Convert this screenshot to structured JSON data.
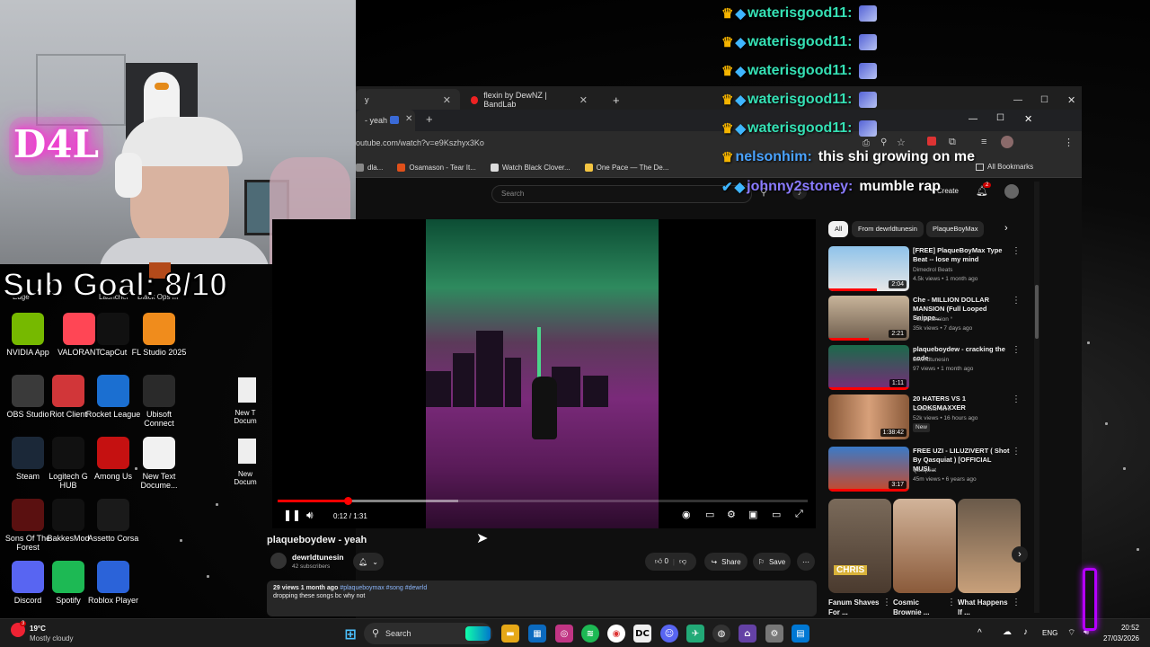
{
  "overlay": {
    "sub_goal": "Sub Goal: 8/10",
    "webcam_neon_text": "D4L",
    "chat": [
      {
        "user": "waterisgood11:",
        "message": ""
      },
      {
        "user": "waterisgood11:",
        "message": ""
      },
      {
        "user": "waterisgood11:",
        "message": ""
      },
      {
        "user": "waterisgood11:",
        "message": ""
      },
      {
        "user": "waterisgood11:",
        "message": ""
      },
      {
        "user": "nelsonhim:",
        "message": "this shi growing on me"
      },
      {
        "user": "johnny2stoney:",
        "message": "mumble rap"
      }
    ]
  },
  "desktop_icons": [
    {
      "label": "NVIDIA App",
      "icon": "nvidia-icon",
      "color": "#76b900"
    },
    {
      "label": "VALORANT",
      "icon": "valorant-icon",
      "color": "#ff4655"
    },
    {
      "label": "CapCut",
      "icon": "capcut-icon",
      "color": "#111111"
    },
    {
      "label": "FL Studio 2025",
      "icon": "fl-studio-icon",
      "color": "#f08c1c"
    },
    {
      "label": "OBS Studio",
      "icon": "obs-icon",
      "color": "#3a3a3a"
    },
    {
      "label": "Riot Client",
      "icon": "riot-icon",
      "color": "#d13639"
    },
    {
      "label": "Rocket League",
      "icon": "rocket-league-icon",
      "color": "#1b6fd1"
    },
    {
      "label": "Ubisoft Connect",
      "icon": "ubisoft-icon",
      "color": "#2a2a2a"
    },
    {
      "label": "Steam",
      "icon": "steam-icon",
      "color": "#1b2838"
    },
    {
      "label": "Logitech G HUB",
      "icon": "logitech-icon",
      "color": "#111111"
    },
    {
      "label": "Among Us",
      "icon": "among-us-icon",
      "color": "#c51111"
    },
    {
      "label": "New Text Docume...",
      "icon": "text-document-icon",
      "color": "#f1f1f1"
    },
    {
      "label": "Sons Of The Forest",
      "icon": "sons-forest-icon",
      "color": "#5a1010"
    },
    {
      "label": "BakkesMod",
      "icon": "bakkesmod-icon",
      "color": "#111111"
    },
    {
      "label": "Assetto Corsa",
      "icon": "assetto-icon",
      "color": "#1a1a1a"
    },
    {
      "label": "Discord",
      "icon": "discord-icon",
      "color": "#5865f2"
    },
    {
      "label": "Spotify",
      "icon": "spotify-icon",
      "color": "#1db954"
    },
    {
      "label": "Roblox Player",
      "icon": "roblox-icon",
      "color": "#2b63d9"
    }
  ],
  "partial_icons": {
    "launcher": "Launcher",
    "black_ops": "Black Ops III",
    "edge": "Edge",
    "new_text_1": "New T Docum",
    "new_text_2": "New Docum"
  },
  "back_browser": {
    "tab1_label": "y",
    "tab2_label": "flexin by DewNZ | BandLab"
  },
  "browser": {
    "tab_label": "- yeah -",
    "url": "outube.com/watch?v=e9Kszhyx3Ko",
    "bookmarks_right": "Bookmarks",
    "all_bookmarks": "All Bookmarks",
    "bookmarks": [
      {
        "label": "dla...",
        "color": "#888888"
      },
      {
        "label": "Osamason - Tear It...",
        "color": "#e0501a"
      },
      {
        "label": "Watch Black Clover...",
        "color": "#dddddd"
      },
      {
        "label": "One Pace — The De...",
        "color": "#f4c542"
      }
    ]
  },
  "youtube": {
    "search_placeholder": "Search",
    "create_label": "Create",
    "notif_count": "2",
    "player": {
      "current_time": "0:12",
      "duration": "1:31",
      "time_display": "0:12 / 1:31",
      "progress_fraction": 0.132,
      "buffer_fraction": 0.34
    },
    "title": "plaqueboydew - yeah",
    "channel": {
      "name": "dewrldtunesin",
      "subscribers": "42 subscribers"
    },
    "actions": {
      "likes": "0",
      "share": "Share",
      "save": "Save"
    },
    "description": {
      "meta": "29 views  1 month ago",
      "tags": "#plaqueboymax #song #dewrld",
      "text": "dropping these songs bc why not"
    },
    "chips": [
      "All",
      "From dewrldtunesin",
      "PlaqueBoyMax"
    ],
    "recommendations": [
      {
        "title": "[FREE] PlaqueBoyMax Type Beat -- lose my mind",
        "channel": "Dimedrol Beats",
        "meta": "4.5k views • 1 month ago",
        "duration": "2:04",
        "badge": "",
        "watched_fraction": 0.6
      },
      {
        "title": "Che - MILLION DOLLAR MANSION (Full Looped Snippe...",
        "channel": "° bubmansion °",
        "meta": "35k views • 7 days ago",
        "duration": "2:21",
        "badge": "",
        "watched_fraction": 0.5
      },
      {
        "title": "plaqueboydew - cracking the code",
        "channel": "dewrldtunesin",
        "meta": "97 views • 1 month ago",
        "duration": "1:11",
        "badge": "",
        "watched_fraction": 1.0
      },
      {
        "title": "20 HATERS VS 1 LOOKSMAXXER",
        "channel": "Clavicular Live",
        "meta": "52k views • 16 hours ago",
        "duration": "1:38:42",
        "badge": "New",
        "watched_fraction": 0
      },
      {
        "title": "FREE UZI - LILUZIVERT ( Shot By Qasquiat ) [OFFICIAL MUSI...",
        "channel": "Qasquiat",
        "meta": "45m views • 6 years ago",
        "duration": "3:17",
        "badge": "",
        "watched_fraction": 1.0
      }
    ],
    "shorts": [
      {
        "title": "Fanum Shaves For ...",
        "overlay": "CHRIS"
      },
      {
        "title": "Cosmic Brownie ...",
        "overlay": ""
      },
      {
        "title": "What Happens If ...",
        "overlay": ""
      }
    ]
  },
  "taskbar": {
    "weather_temp": "19°C",
    "weather_desc": "Mostly cloudy",
    "search_label": "Search",
    "language": "ENG",
    "time": "20:52",
    "date": "27/03/2026",
    "weather_badge": "3"
  }
}
